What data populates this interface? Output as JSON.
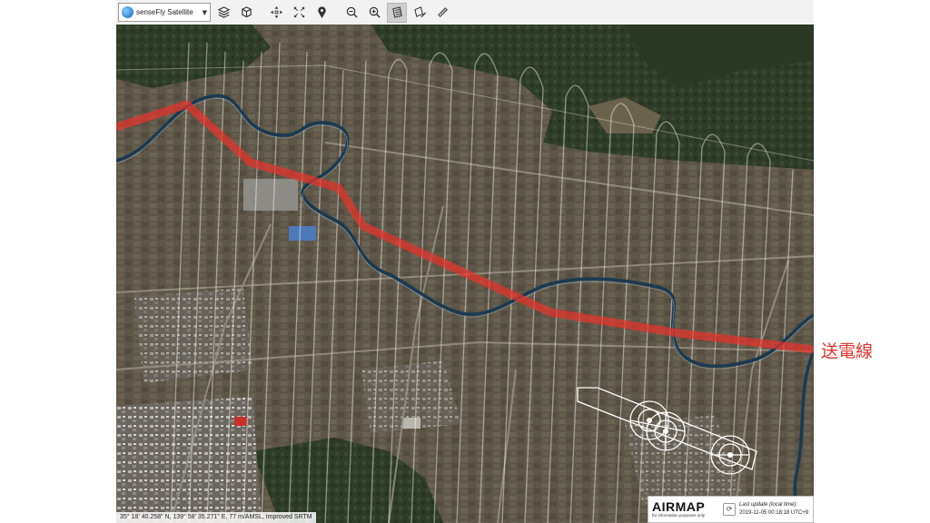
{
  "map_source": {
    "label": "senseFly Satellite",
    "icon": "globe-icon"
  },
  "toolbar": {
    "tools": [
      "layers-icon",
      "3d-view-icon",
      "zoom-extent-icon",
      "pan-icon",
      "location-pin-icon",
      "zoom-out-icon",
      "zoom-in-icon",
      "flight-plan-icon",
      "edit-area-icon",
      "ruler-icon"
    ]
  },
  "status": {
    "coordinates": "35° 18' 40.258\" N, 139° 58' 35.271\" E, 77 m/AMSL, Improved SRTM"
  },
  "airmap": {
    "logo": "AIRMAP",
    "disclaimer": "for information purposes only",
    "update_label": "Last update (local time):",
    "update_time": "2019-11-05 00:18:18 UTC+9"
  },
  "annotation": {
    "text": "送電線",
    "color": "#e8332b"
  },
  "colors": {
    "power_line": "#e8332b",
    "river": "#1a3a52",
    "forest": "#2b3a26",
    "fields": "#5b5446"
  }
}
